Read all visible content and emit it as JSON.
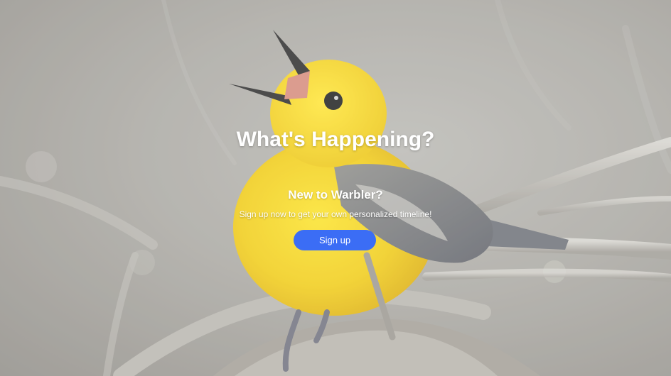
{
  "hero": {
    "headline": "What's Happening?",
    "subheading": "New to Warbler?",
    "tagline": "Sign up now to get your own personalized timeline!",
    "signup_label": "Sign up",
    "background_image": "bird-photo",
    "colors": {
      "button": "#3b6df5",
      "text": "#ffffff",
      "bird_yellow": "#f3d21a"
    }
  }
}
